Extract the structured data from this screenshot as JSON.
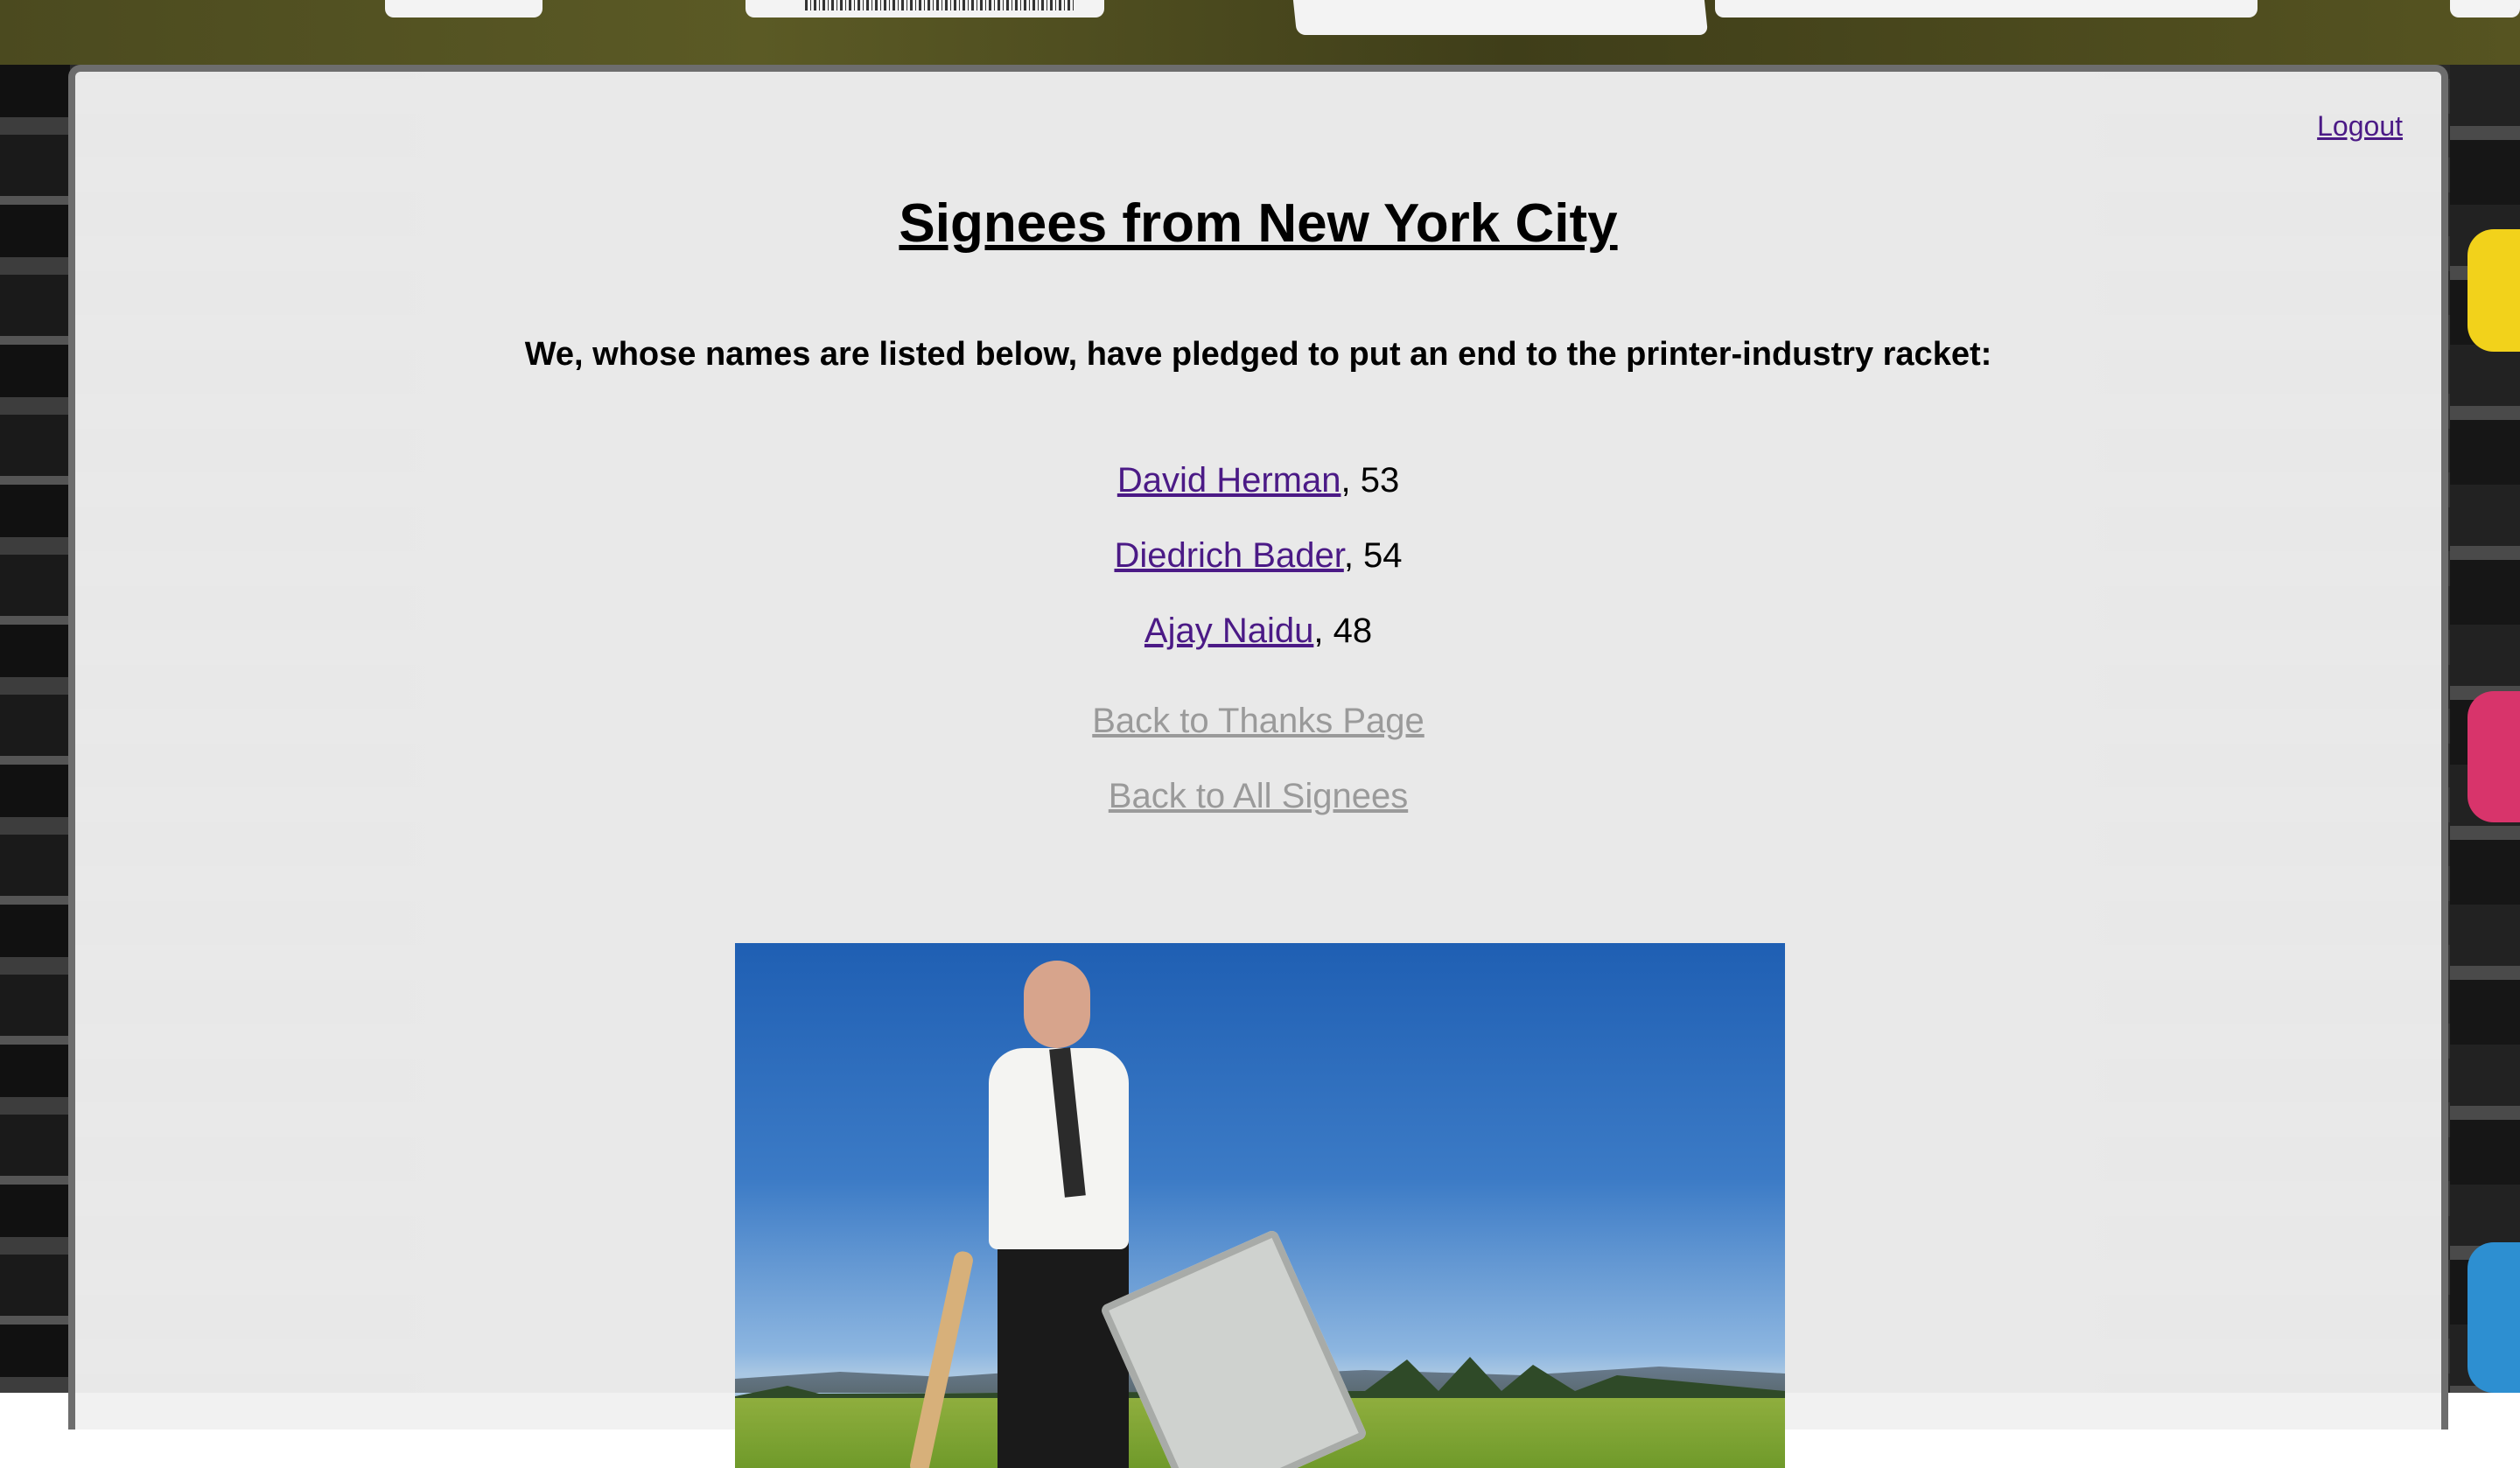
{
  "header": {
    "logout_label": "Logout"
  },
  "page": {
    "title": "Signees from New York City",
    "pledge_text": "We, whose names are listed below, have pledged to put an end to the printer-industry racket:"
  },
  "signees": [
    {
      "name": "David Herman",
      "age_text": ", 53"
    },
    {
      "name": "Diedrich Bader",
      "age_text": ", 54"
    },
    {
      "name": "Ajay Naidu",
      "age_text": ", 48"
    }
  ],
  "navigation": {
    "back_to_thanks": "Back to Thanks Page",
    "back_to_all_signees": "Back to All Signees"
  },
  "colors": {
    "visited_link": "#4b1a86",
    "muted_link": "#9a9a9a",
    "panel_bg": "#f0f0f0",
    "panel_border": "#6d6d6d"
  }
}
